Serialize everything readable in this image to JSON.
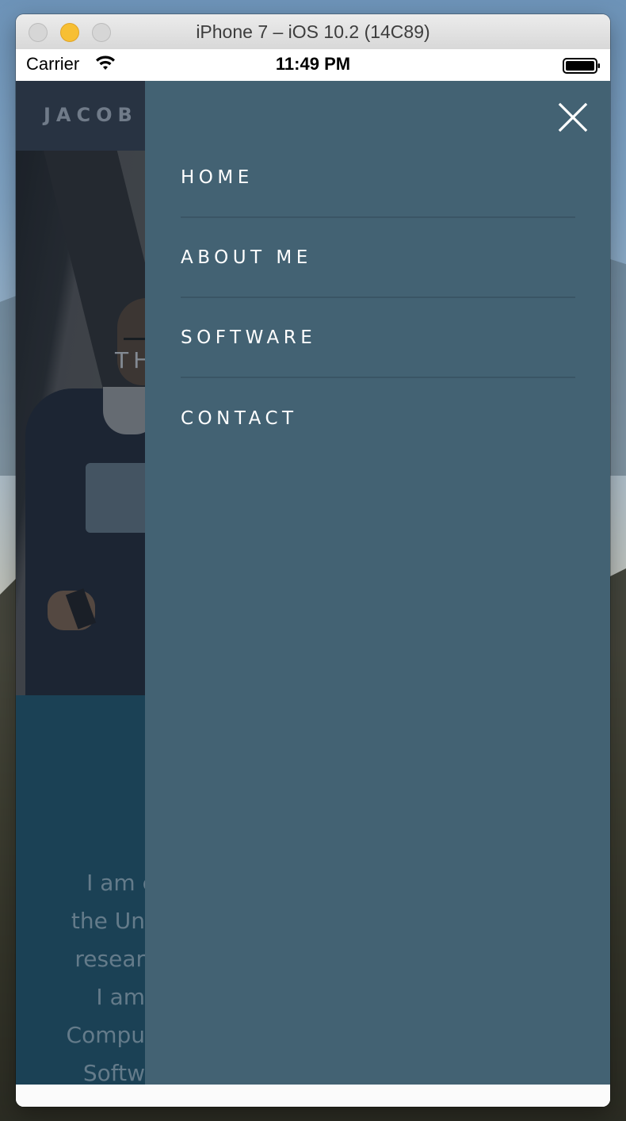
{
  "window": {
    "title": "iPhone 7 – iOS 10.2 (14C89)"
  },
  "status_bar": {
    "carrier": "Carrier",
    "wifi_icon": "wifi-icon",
    "time": "11:49 PM",
    "battery_icon": "battery-icon"
  },
  "site": {
    "brand": "JACOB S",
    "hero_heading": "TH",
    "about_lines": [
      "I am c",
      "the Un",
      "resear",
      "I am",
      "Compu",
      "Softw"
    ]
  },
  "menu": {
    "close_icon": "close-icon",
    "items": [
      {
        "label": "HOME"
      },
      {
        "label": "ABOUT ME"
      },
      {
        "label": "SOFTWARE"
      },
      {
        "label": "CONTACT"
      }
    ]
  },
  "colors": {
    "menu_background": "#436273",
    "menu_divider": "#3a5565",
    "site_nav": "#2f3744",
    "about_section": "#1e4a5e",
    "traffic_minimize": "#f7bf33"
  }
}
